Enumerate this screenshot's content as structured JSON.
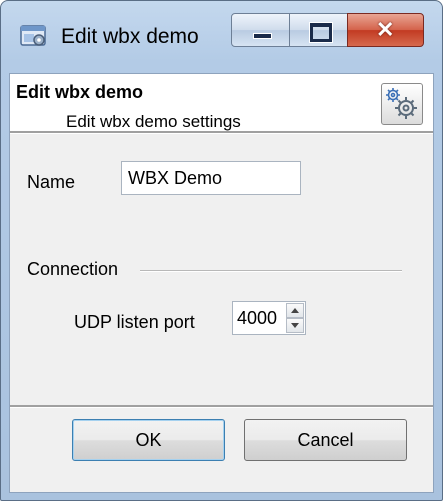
{
  "window": {
    "title": "Edit wbx demo",
    "close_glyph": "✕"
  },
  "header": {
    "title": "Edit wbx demo",
    "subtitle": "Edit wbx demo settings",
    "icon": "gears-settings-icon"
  },
  "form": {
    "name_label": "Name",
    "name_value": "WBX Demo",
    "connection_group_label": "Connection",
    "udp_label": "UDP listen port",
    "udp_value": "4000"
  },
  "buttons": {
    "ok_label": "OK",
    "cancel_label": "Cancel"
  },
  "colors": {
    "titlebar": "#b9cfe8",
    "client_bg": "#f0f0f0",
    "close_button": "#c94a30"
  }
}
